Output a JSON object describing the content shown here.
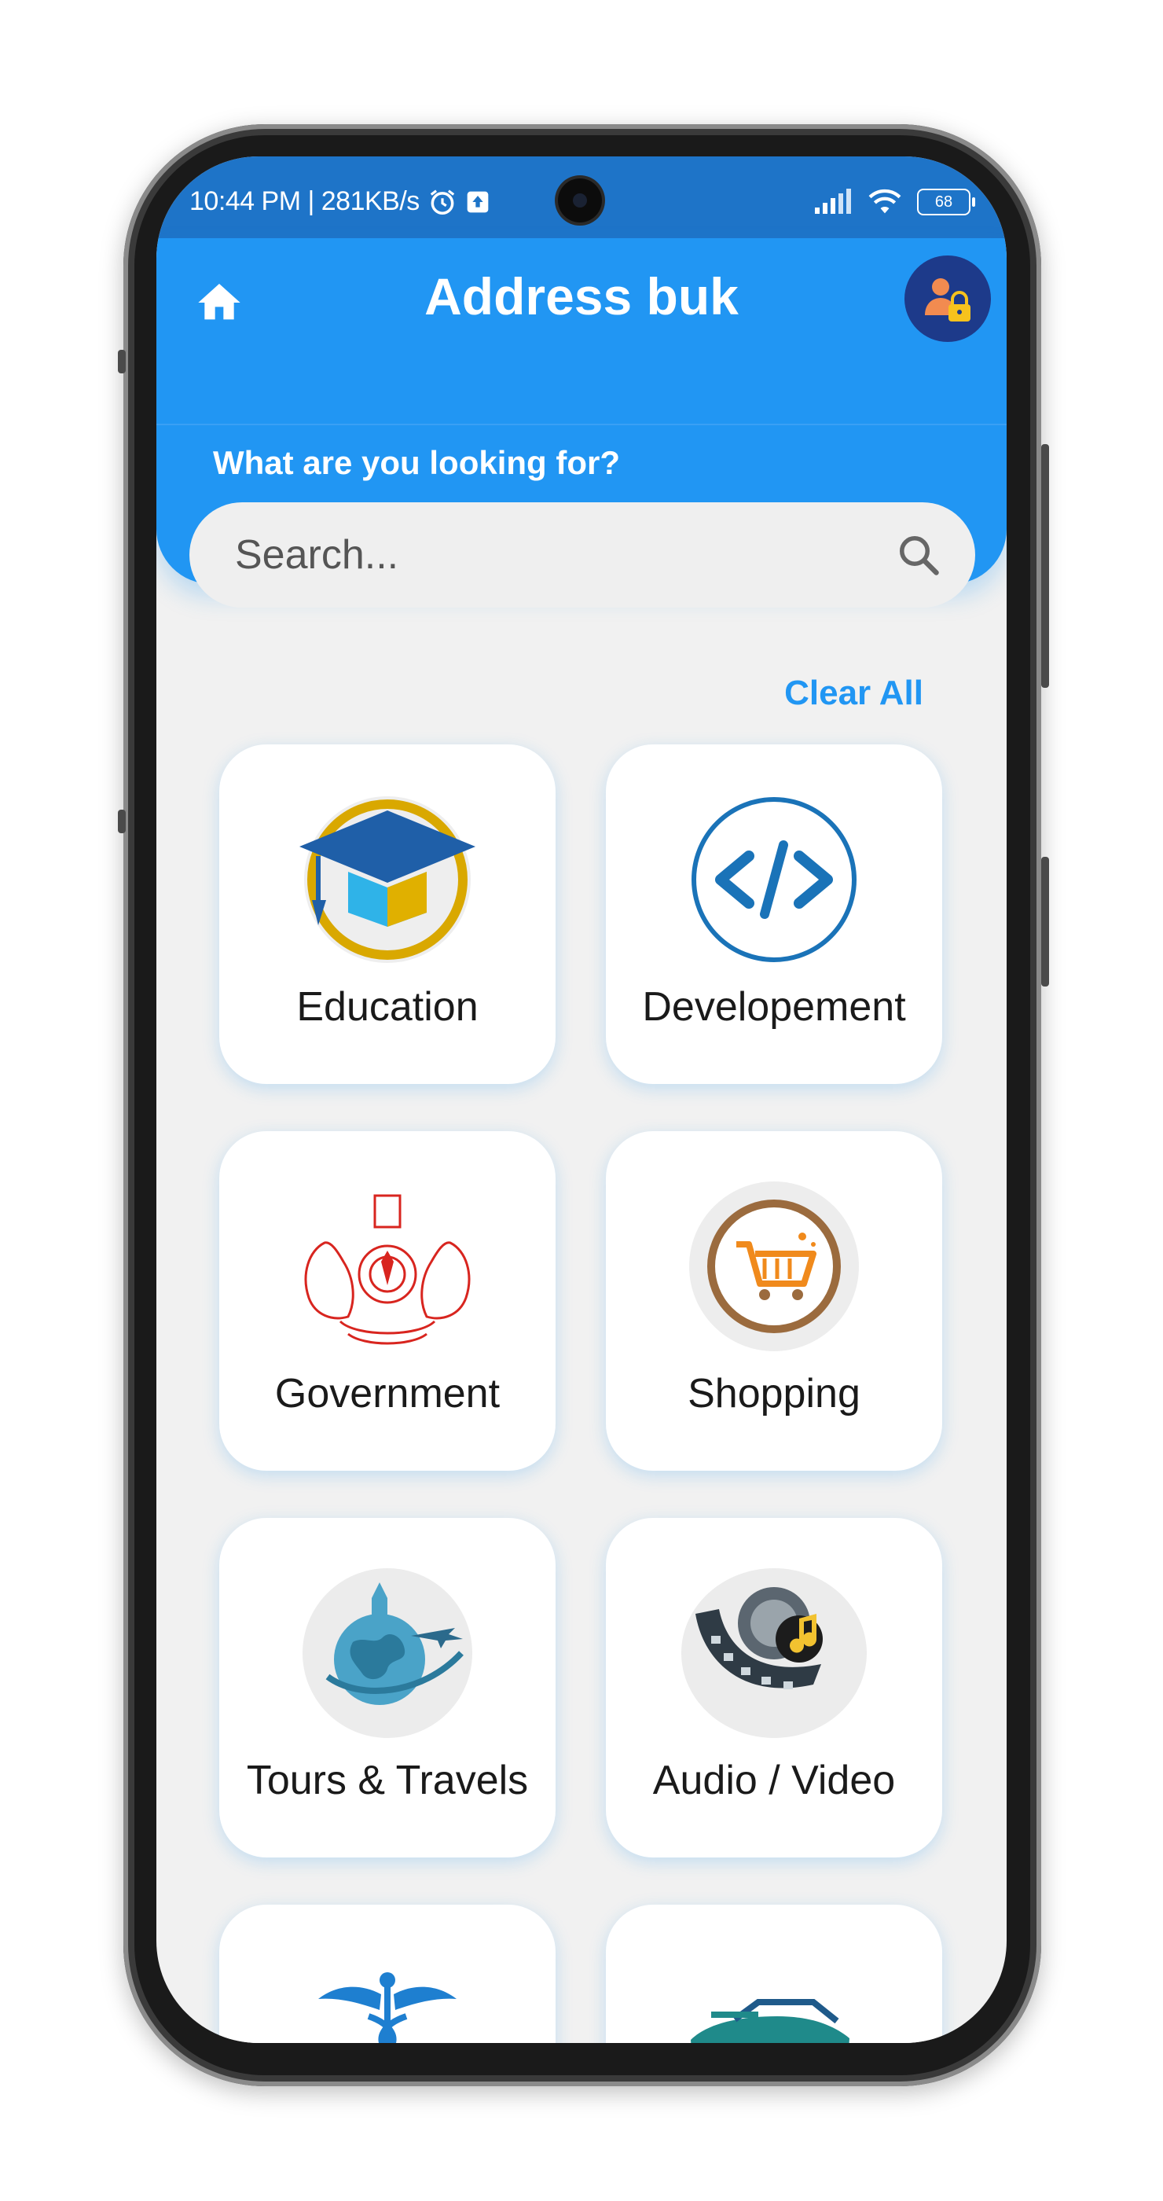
{
  "status_bar": {
    "time_speed": "10:44 PM | 281KB/s",
    "battery": "68"
  },
  "header": {
    "title": "Address buk",
    "question": "What are you looking for?"
  },
  "search": {
    "placeholder": "Search..."
  },
  "actions": {
    "clear_all": "Clear All"
  },
  "categories": [
    {
      "label": "Education",
      "icon": "graduation-cap-icon"
    },
    {
      "label": "Developement",
      "icon": "code-icon"
    },
    {
      "label": "Government",
      "icon": "kerala-emblem-icon"
    },
    {
      "label": "Shopping",
      "icon": "shopping-cart-icon"
    },
    {
      "label": "Tours & Travels",
      "icon": "globe-airplane-icon"
    },
    {
      "label": "Audio / Video",
      "icon": "film-reel-music-icon"
    },
    {
      "label": "",
      "icon": "caduceus-icon"
    },
    {
      "label": "",
      "icon": "car-icon"
    }
  ],
  "colors": {
    "primary": "#2196f3",
    "status_bar": "#1e74c8",
    "background": "#f1f1f1",
    "accent_link": "#2196f3"
  }
}
